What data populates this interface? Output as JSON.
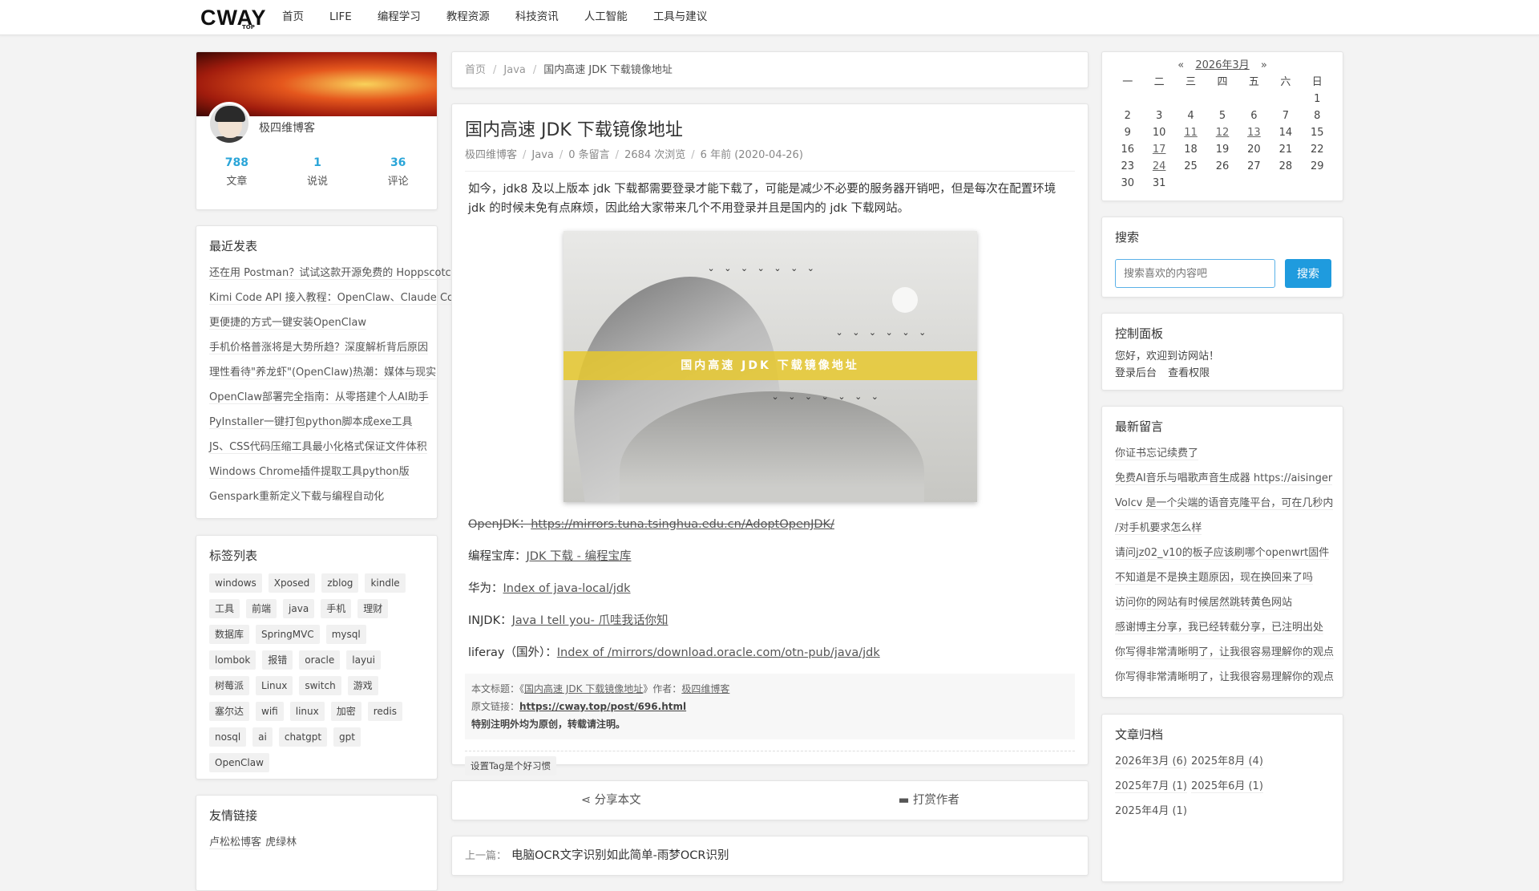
{
  "logo": {
    "text": "CWAY",
    "sub": "TOP"
  },
  "nav": [
    "首页",
    "LIFE",
    "编程学习",
    "教程资源",
    "科技资讯",
    "人工智能",
    "工具与建议"
  ],
  "profile": {
    "name": "极四维博客",
    "stats": [
      {
        "num": "788",
        "label": "文章"
      },
      {
        "num": "1",
        "label": "说说"
      },
      {
        "num": "36",
        "label": "评论"
      }
    ]
  },
  "recent": {
    "title": "最近发表",
    "items": [
      "还在用 Postman？试试这款开源免费的 Hoppscotch",
      "Kimi Code API 接入教程：OpenClaw、Claude Code",
      "更便捷的方式一键安装OpenClaw",
      "手机价格普涨将是大势所趋？深度解析背后原因",
      "理性看待\"养龙虾\"(OpenClaw)热潮：媒体与现实",
      "OpenClaw部署完全指南：从零搭建个人AI助手",
      "PyInstaller一键打包python脚本成exe工具",
      "JS、CSS代码压缩工具最小化格式保证文件体积",
      "Windows Chrome插件提取工具python版",
      "Genspark重新定义下载与编程自动化"
    ]
  },
  "tags": {
    "title": "标签列表",
    "items": [
      "windows",
      "Xposed",
      "zblog",
      "kindle",
      "工具",
      "前端",
      "java",
      "手机",
      "理财",
      "数据库",
      "SpringMVC",
      "mysql",
      "lombok",
      "报错",
      "oracle",
      "layui",
      "树莓派",
      "Linux",
      "switch",
      "游戏",
      "塞尔达",
      "wifi",
      "linux",
      "加密",
      "redis",
      "nosql",
      "ai",
      "chatgpt",
      "gpt",
      "OpenClaw"
    ]
  },
  "links": {
    "title": "友情链接",
    "items": [
      "卢松松博客",
      "虎绿林"
    ]
  },
  "breadcrumb": {
    "home": "首页",
    "cat": "Java",
    "current": "国内高速 JDK 下载镜像地址"
  },
  "article": {
    "title": "国内高速 JDK 下载镜像地址",
    "meta": {
      "author": "极四维博客",
      "cat": "Java",
      "comments": "0 条留言",
      "views": "2684 次浏览",
      "date": "6 年前 (2020-04-26)"
    },
    "intro": "如今，jdk8 及以上版本 jdk 下载都需要登录才能下载了，可能是减少不必要的服务器开销吧，但是每次在配置环境 jdk 的时候未免有点麻烦，因此给大家带来几个不用登录并且是国内的 jdk 下载网站。",
    "hero_text": "国内高速 JDK 下载镜像地址",
    "rows": [
      {
        "label": "OpenJDK：",
        "link": "https://mirrors.tuna.tsinghua.edu.cn/AdoptOpenJDK/"
      },
      {
        "label": "编程宝库：",
        "link": "JDK 下载 - 编程宝库"
      },
      {
        "label": "华为：",
        "link": "Index of java-local/jdk"
      },
      {
        "label": "INJDK：",
        "link": "Java I tell you- 爪哇我话你知"
      },
      {
        "label": "liferay（国外）：",
        "link": "Index of /mirrors/download.oracle.com/otn-pub/java/jdk"
      }
    ],
    "copyright": {
      "l1_pre": "本文标题：《",
      "l1_title": "国内高速 JDK 下载镜像地址",
      "l1_mid": "》作者：",
      "l1_author": "极四维博客",
      "l2_label": "原文链接：",
      "l2_url": "https://cway.top/post/696.html",
      "l3": "特别注明外均为原创，转载请注明。"
    },
    "tag_line": "设置Tag是个好习惯"
  },
  "share": {
    "share": "分享本文",
    "reward": "打赏作者"
  },
  "prev": {
    "label": "上一篇：",
    "title": "电脑OCR文字识别如此简单-雨梦OCR识别"
  },
  "calendar": {
    "prev": "«",
    "next": "»",
    "month": "2026年3月",
    "weekdays": [
      "一",
      "二",
      "三",
      "四",
      "五",
      "六",
      "日"
    ],
    "linked_days": [
      11,
      12,
      13,
      17,
      24
    ]
  },
  "search": {
    "title": "搜索",
    "placeholder": "搜索喜欢的内容吧",
    "button": "搜索"
  },
  "panel": {
    "title": "控制面板",
    "welcome": "您好，欢迎到访网站！",
    "login": "登录后台",
    "perm": "查看权限"
  },
  "comments": {
    "title": "最新留言",
    "items": [
      "你证书忘记续费了",
      "免费AI音乐与唱歌声音生成器 https://aisinger",
      "Volcv 是一个尖端的语音克隆平台，可在几秒内",
      "/对手机要求怎么样",
      "请问jz02_v10的板子应该刷哪个openwrt固件",
      "不知道是不是换主题原因，现在换回来了吗",
      "访问你的网站有时候居然跳转黄色网站",
      "感谢博主分享，我已经转载分享，已注明出处",
      "你写得非常清晰明了，让我很容易理解你的观点",
      "你写得非常清晰明了，让我很容易理解你的观点"
    ]
  },
  "archive": {
    "title": "文章归档",
    "items": [
      "2026年3月 (6)",
      "2025年8月 (4)",
      "2025年7月 (1)",
      "2025年6月 (1)",
      "2025年4月 (1)"
    ]
  },
  "colors": {
    "accent": "#1f9bde",
    "stat": "#2aa5d8",
    "hero_band": "#e8c828"
  }
}
